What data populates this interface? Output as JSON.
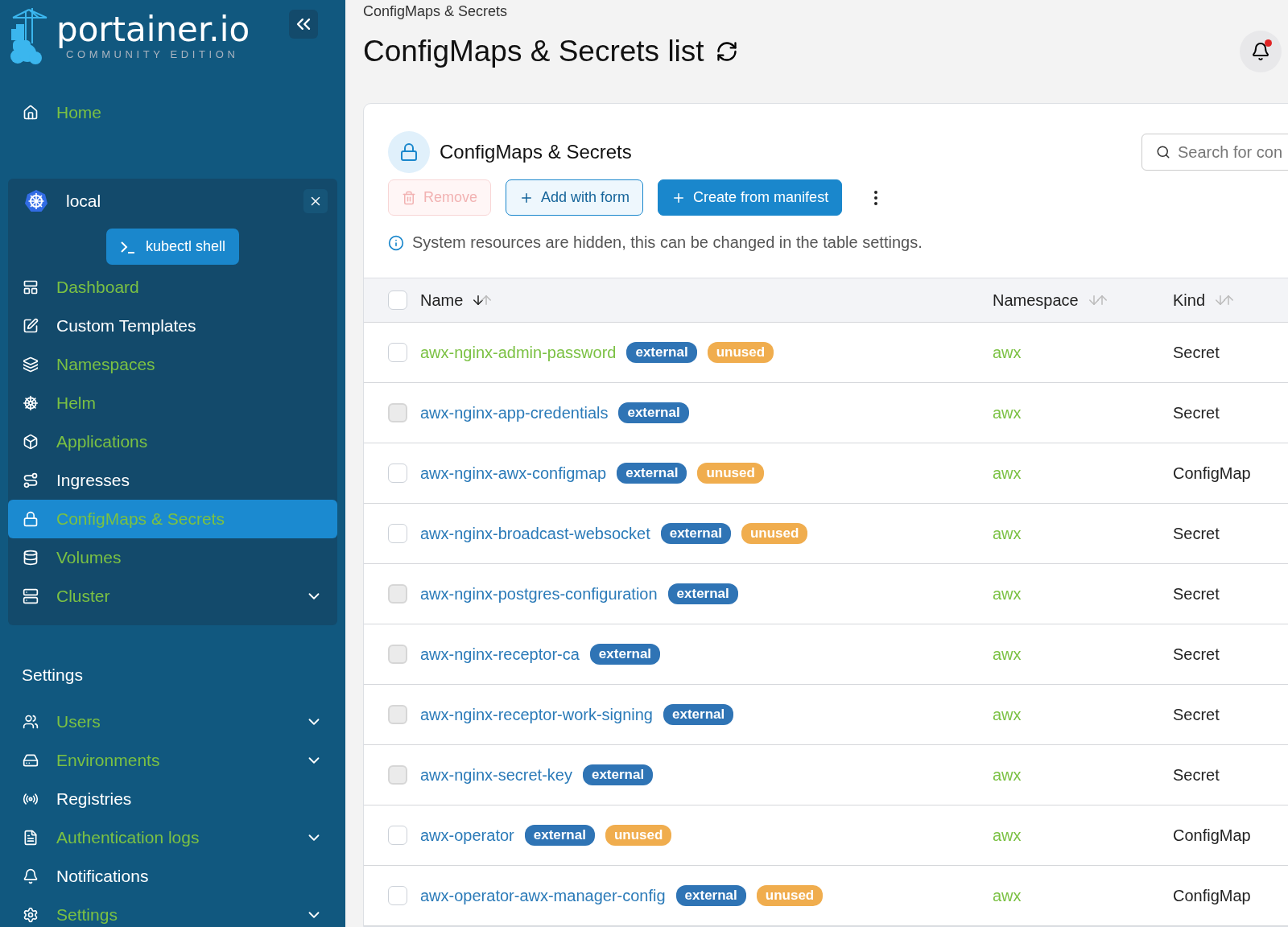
{
  "sidebar": {
    "logo": {
      "name": "portainer.io",
      "edition": "COMMUNITY EDITION"
    },
    "home": {
      "label": "Home",
      "visited": true
    },
    "environment": {
      "name": "local",
      "shell_button": "kubectl shell",
      "items": [
        {
          "label": "Dashboard",
          "visited": true,
          "selected": false,
          "expandable": false
        },
        {
          "label": "Custom Templates",
          "visited": false,
          "selected": false,
          "expandable": false
        },
        {
          "label": "Namespaces",
          "visited": true,
          "selected": false,
          "expandable": false
        },
        {
          "label": "Helm",
          "visited": true,
          "selected": false,
          "expandable": false
        },
        {
          "label": "Applications",
          "visited": true,
          "selected": false,
          "expandable": false
        },
        {
          "label": "Ingresses",
          "visited": false,
          "selected": false,
          "expandable": false
        },
        {
          "label": "ConfigMaps & Secrets",
          "visited": true,
          "selected": true,
          "expandable": false
        },
        {
          "label": "Volumes",
          "visited": true,
          "selected": false,
          "expandable": false
        },
        {
          "label": "Cluster",
          "visited": true,
          "selected": false,
          "expandable": true
        }
      ]
    },
    "settings": {
      "heading": "Settings",
      "items": [
        {
          "label": "Users",
          "visited": true,
          "expandable": true
        },
        {
          "label": "Environments",
          "visited": true,
          "expandable": true
        },
        {
          "label": "Registries",
          "visited": false,
          "expandable": false
        },
        {
          "label": "Authentication logs",
          "visited": true,
          "expandable": true
        },
        {
          "label": "Notifications",
          "visited": false,
          "expandable": false
        },
        {
          "label": "Settings",
          "visited": true,
          "expandable": true
        }
      ]
    }
  },
  "breadcrumb": "ConfigMaps & Secrets",
  "page_title": "ConfigMaps & Secrets list",
  "card": {
    "title": "ConfigMaps & Secrets",
    "search": {
      "placeholder": "Search for con"
    },
    "buttons": [
      {
        "kind": "remove",
        "label": "Remove",
        "disabled": true
      },
      {
        "kind": "outline",
        "label": "Add with form",
        "disabled": false
      },
      {
        "kind": "primary",
        "label": "Create from manifest",
        "disabled": false
      }
    ],
    "info": "System resources are hidden, this can be changed in the table settings.",
    "table": {
      "select_all": {
        "checked": false
      },
      "columns": [
        "Name",
        "Namespace",
        "Kind"
      ],
      "rows": [
        {
          "name": "awx-nginx-admin-password",
          "visited": true,
          "disabled": false,
          "badges": [
            "external",
            "unused"
          ],
          "namespace": "awx",
          "kind": "Secret"
        },
        {
          "name": "awx-nginx-app-credentials",
          "visited": false,
          "disabled": true,
          "badges": [
            "external"
          ],
          "namespace": "awx",
          "kind": "Secret"
        },
        {
          "name": "awx-nginx-awx-configmap",
          "visited": false,
          "disabled": false,
          "badges": [
            "external",
            "unused"
          ],
          "namespace": "awx",
          "kind": "ConfigMap"
        },
        {
          "name": "awx-nginx-broadcast-websocket",
          "visited": false,
          "disabled": false,
          "badges": [
            "external",
            "unused"
          ],
          "namespace": "awx",
          "kind": "Secret"
        },
        {
          "name": "awx-nginx-postgres-configuration",
          "visited": false,
          "disabled": true,
          "badges": [
            "external"
          ],
          "namespace": "awx",
          "kind": "Secret"
        },
        {
          "name": "awx-nginx-receptor-ca",
          "visited": false,
          "disabled": true,
          "badges": [
            "external"
          ],
          "namespace": "awx",
          "kind": "Secret"
        },
        {
          "name": "awx-nginx-receptor-work-signing",
          "visited": false,
          "disabled": true,
          "badges": [
            "external"
          ],
          "namespace": "awx",
          "kind": "Secret"
        },
        {
          "name": "awx-nginx-secret-key",
          "visited": false,
          "disabled": true,
          "badges": [
            "external"
          ],
          "namespace": "awx",
          "kind": "Secret"
        },
        {
          "name": "awx-operator",
          "visited": false,
          "disabled": false,
          "badges": [
            "external",
            "unused"
          ],
          "namespace": "awx",
          "kind": "ConfigMap"
        },
        {
          "name": "awx-operator-awx-manager-config",
          "visited": false,
          "disabled": false,
          "badges": [
            "external",
            "unused"
          ],
          "namespace": "awx",
          "kind": "ConfigMap"
        }
      ]
    }
  }
}
